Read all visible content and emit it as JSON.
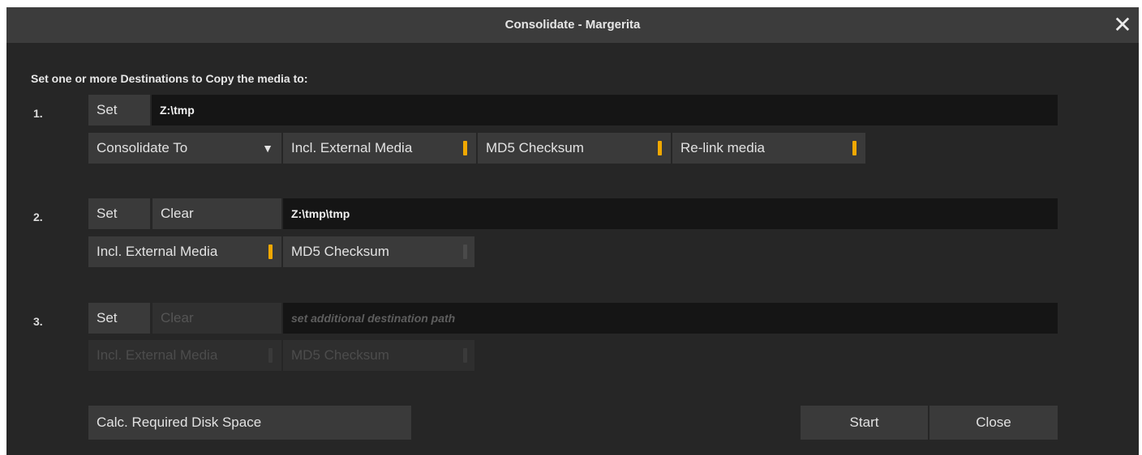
{
  "window": {
    "title": "Consolidate - Margerita",
    "close_glyph": "✕",
    "accent_color": "#f0a800"
  },
  "heading": "Set one or more Destinations to Copy the media to:",
  "destinations": [
    {
      "number": "1.",
      "set_label": "Set",
      "path": "Z:\\tmp",
      "mode_label": "Consolidate To",
      "mode_icon": "dropdown-triangle-icon",
      "caret_glyph": "▼",
      "toggles": [
        {
          "label": "Incl. External Media",
          "on": true
        },
        {
          "label": "MD5 Checksum",
          "on": true
        },
        {
          "label": "Re-link media",
          "on": true
        }
      ]
    },
    {
      "number": "2.",
      "set_label": "Set",
      "clear_label": "Clear",
      "path": "Z:\\tmp\\tmp",
      "toggles": [
        {
          "label": "Incl. External Media",
          "on": true
        },
        {
          "label": "MD5 Checksum",
          "on": false
        }
      ]
    },
    {
      "number": "3.",
      "set_label": "Set",
      "clear_label": "Clear",
      "path_placeholder": "set additional destination path",
      "toggles": [
        {
          "label": "Incl. External Media",
          "on": false
        },
        {
          "label": "MD5 Checksum",
          "on": false
        }
      ]
    }
  ],
  "footer": {
    "calc_label": "Calc. Required Disk Space",
    "start_label": "Start",
    "close_label": "Close"
  }
}
